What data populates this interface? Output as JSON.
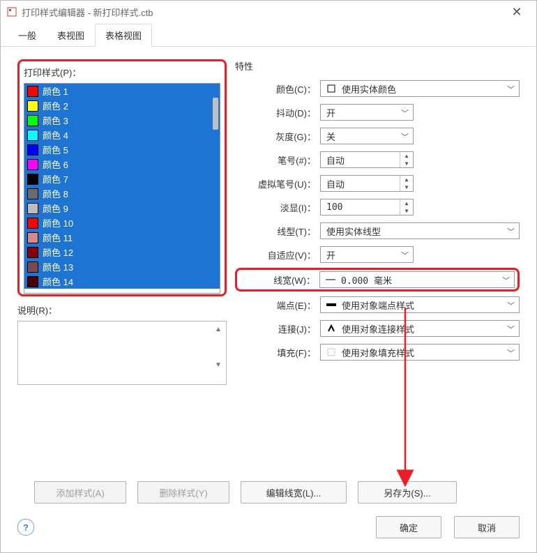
{
  "window": {
    "title": "打印样式编辑器 - 新打印样式.ctb"
  },
  "tabs": {
    "t0": "一般",
    "t1": "表视图",
    "t2": "表格视图"
  },
  "left": {
    "header": "打印样式(P)：",
    "items": [
      {
        "label": "颜色 1",
        "color": "#ff0000"
      },
      {
        "label": "颜色 2",
        "color": "#ffff00"
      },
      {
        "label": "颜色 3",
        "color": "#00ff00"
      },
      {
        "label": "颜色 4",
        "color": "#00ffff"
      },
      {
        "label": "颜色 5",
        "color": "#0000ff"
      },
      {
        "label": "颜色 6",
        "color": "#ff00ff"
      },
      {
        "label": "颜色 7",
        "color": "#000000"
      },
      {
        "label": "颜色 8",
        "color": "#6b6b6b"
      },
      {
        "label": "颜色 9",
        "color": "#bdbdbd"
      },
      {
        "label": "颜色 10",
        "color": "#ff0000"
      },
      {
        "label": "颜色 11",
        "color": "#d98787"
      },
      {
        "label": "颜色 12",
        "color": "#8b0000"
      },
      {
        "label": "颜色 13",
        "color": "#7a4a4a"
      },
      {
        "label": "颜色 14",
        "color": "#4a0000"
      }
    ],
    "desc_label": "说明(R)："
  },
  "right": {
    "header": "特性",
    "color_label": "颜色(C)：",
    "color_value": "使用实体颜色",
    "dither_label": "抖动(D)：",
    "dither_value": "开",
    "gray_label": "灰度(G)：",
    "gray_value": "关",
    "pen_label": "笔号(#)：",
    "pen_value": "自动",
    "vpen_label": "虚拟笔号(U)：",
    "vpen_value": "自动",
    "screen_label": "淡显(I)：",
    "screen_value": "100",
    "ltype_label": "线型(T)：",
    "ltype_value": "使用实体线型",
    "adapt_label": "自适应(V)：",
    "adapt_value": "开",
    "lw_label": "线宽(W)：",
    "lw_value": "0.000 毫米",
    "end_label": "端点(E)：",
    "end_value": "使用对象端点样式",
    "join_label": "连接(J)：",
    "join_value": "使用对象连接样式",
    "fill_label": "填充(F)：",
    "fill_value": "使用对象填充样式"
  },
  "buttons": {
    "add": "添加样式(A)",
    "del": "删除样式(Y)",
    "editlw": "编辑线宽(L)...",
    "saveas": "另存为(S)...",
    "ok": "确定",
    "cancel": "取消"
  }
}
